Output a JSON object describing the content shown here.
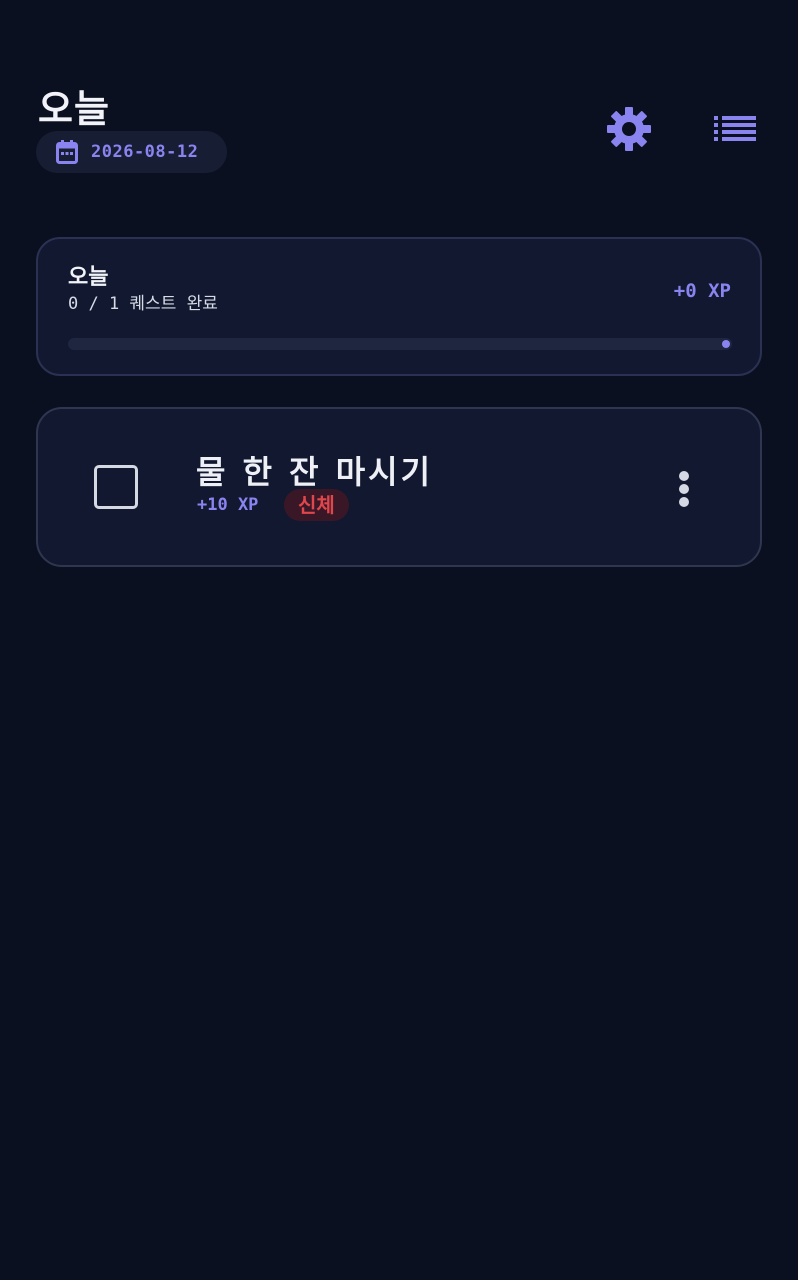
{
  "header": {
    "title": "오늘",
    "date": "2026-08-12",
    "icons": {
      "calendar": "calendar-icon",
      "settings": "gear-icon",
      "menu": "list-icon"
    }
  },
  "summary": {
    "title": "오늘",
    "progress_text": "0 / 1 퀘스트 완료",
    "xp_label": "+0 XP",
    "progress_fraction": 0
  },
  "quests": [
    {
      "title": "물 한 잔 마시기",
      "xp": "+10 XP",
      "category": "신체",
      "completed": false
    }
  ],
  "colors": {
    "background": "#0b1020",
    "card": "#111830",
    "accent": "#8a84f0",
    "tag_text": "#e0474c",
    "tag_bg": "#3a1727"
  }
}
